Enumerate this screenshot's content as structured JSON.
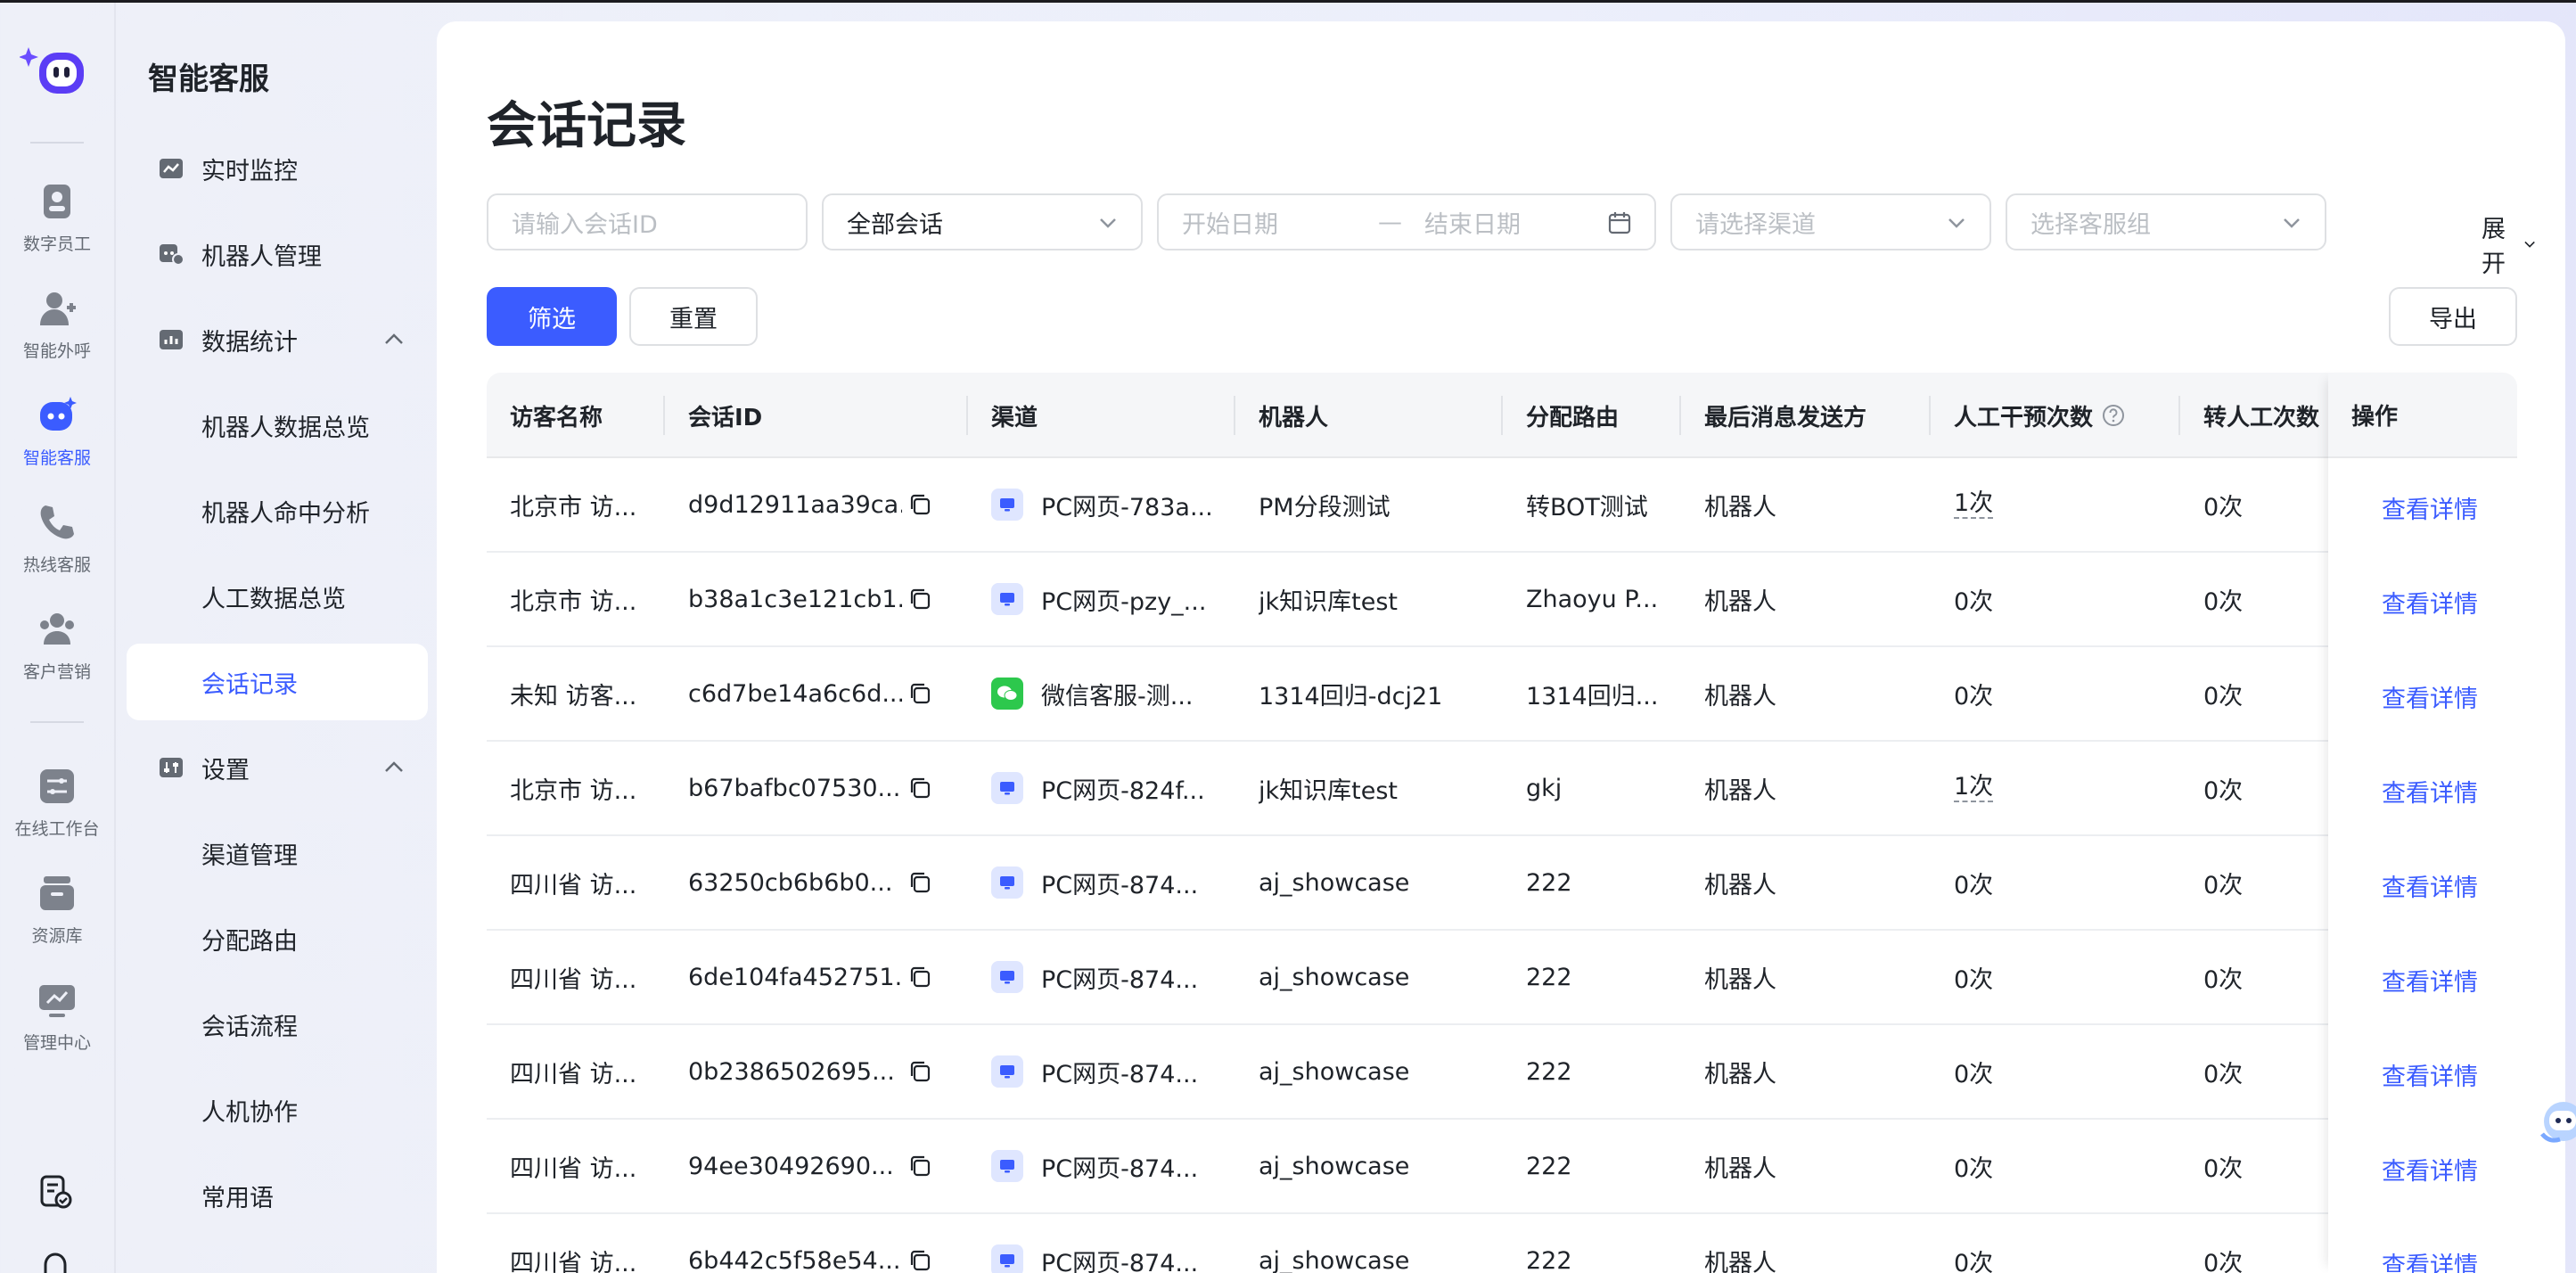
{
  "app": {
    "rail": [
      {
        "label": "数字员工",
        "icon": "digital-employee-icon",
        "active": false
      },
      {
        "label": "智能外呼",
        "icon": "outbound-call-icon",
        "active": false
      },
      {
        "label": "智能客服",
        "icon": "smart-service-icon",
        "active": true
      },
      {
        "label": "热线客服",
        "icon": "hotline-icon",
        "active": false
      },
      {
        "label": "客户营销",
        "icon": "marketing-icon",
        "active": false
      },
      {
        "label": "在线工作台",
        "icon": "workbench-icon",
        "active": false
      },
      {
        "label": "资源库",
        "icon": "resource-icon",
        "active": false
      },
      {
        "label": "管理中心",
        "icon": "admin-icon",
        "active": false
      }
    ]
  },
  "menu": {
    "title": "智能客服",
    "items": [
      {
        "label": "实时监控"
      },
      {
        "label": "机器人管理"
      },
      {
        "label": "数据统计"
      },
      {
        "label": "机器人数据总览"
      },
      {
        "label": "机器人命中分析"
      },
      {
        "label": "人工数据总览"
      },
      {
        "label": "会话记录"
      },
      {
        "label": "设置"
      },
      {
        "label": "渠道管理"
      },
      {
        "label": "分配路由"
      },
      {
        "label": "会话流程"
      },
      {
        "label": "人机协作"
      },
      {
        "label": "常用语"
      }
    ]
  },
  "page": {
    "title": "会话记录",
    "filters": {
      "session_id_placeholder": "请输入会话ID",
      "session_type_value": "全部会话",
      "start_date_placeholder": "开始日期",
      "date_separator": "—",
      "end_date_placeholder": "结束日期",
      "channel_placeholder": "请选择渠道",
      "group_placeholder": "选择客服组",
      "expand_label": "展开"
    },
    "buttons": {
      "filter": "筛选",
      "reset": "重置",
      "export": "导出"
    }
  },
  "table": {
    "columns": [
      "访客名称",
      "会话ID",
      "渠道",
      "机器人",
      "分配路由",
      "最后消息发送方",
      "人工干预次数",
      "转人工次数",
      "操作"
    ],
    "action_label": "查看详情",
    "rows": [
      {
        "visitor": "北京市 访...",
        "session_id": "d9d12911aa39ca...",
        "channel": "PC网页-783a...",
        "channel_type": "pc",
        "robot": "PM分段测试",
        "route": "转BOT测试",
        "last_sender": "机器人",
        "intervene": "1次",
        "transfer": "0次"
      },
      {
        "visitor": "北京市 访...",
        "session_id": "b38a1c3e121cb1...",
        "channel": "PC网页-pzy_...",
        "channel_type": "pc",
        "robot": "jk知识库test",
        "route": "Zhaoyu P...",
        "last_sender": "机器人",
        "intervene": "0次",
        "transfer": "0次"
      },
      {
        "visitor": "未知 访客...",
        "session_id": "c6d7be14a6c6d...",
        "channel": "微信客服-测...",
        "channel_type": "wechat",
        "robot": "1314回归-dcj21",
        "route": "1314回归...",
        "last_sender": "机器人",
        "intervene": "0次",
        "transfer": "0次"
      },
      {
        "visitor": "北京市 访...",
        "session_id": "b67bafbc07530...",
        "channel": "PC网页-824f...",
        "channel_type": "pc",
        "robot": "jk知识库test",
        "route": "gkj",
        "last_sender": "机器人",
        "intervene": "1次",
        "transfer": "0次"
      },
      {
        "visitor": "四川省 访...",
        "session_id": "63250cb6b6b0...",
        "channel": "PC网页-874...",
        "channel_type": "pc",
        "robot": "aj_showcase",
        "route": "222",
        "last_sender": "机器人",
        "intervene": "0次",
        "transfer": "0次"
      },
      {
        "visitor": "四川省 访...",
        "session_id": "6de104fa452751...",
        "channel": "PC网页-874...",
        "channel_type": "pc",
        "robot": "aj_showcase",
        "route": "222",
        "last_sender": "机器人",
        "intervene": "0次",
        "transfer": "0次"
      },
      {
        "visitor": "四川省 访...",
        "session_id": "0b2386502695...",
        "channel": "PC网页-874...",
        "channel_type": "pc",
        "robot": "aj_showcase",
        "route": "222",
        "last_sender": "机器人",
        "intervene": "0次",
        "transfer": "0次"
      },
      {
        "visitor": "四川省 访...",
        "session_id": "94ee30492690...",
        "channel": "PC网页-874...",
        "channel_type": "pc",
        "robot": "aj_showcase",
        "route": "222",
        "last_sender": "机器人",
        "intervene": "0次",
        "transfer": "0次"
      },
      {
        "visitor": "四川省 访...",
        "session_id": "6b442c5f58e54...",
        "channel": "PC网页-874...",
        "channel_type": "pc",
        "robot": "aj_showcase",
        "route": "222",
        "last_sender": "机器人",
        "intervene": "0次",
        "transfer": "0次"
      }
    ]
  },
  "colors": {
    "accent": "#3b5cff",
    "wechat": "#2dc84d",
    "menu_bg": "#eef0f8"
  }
}
